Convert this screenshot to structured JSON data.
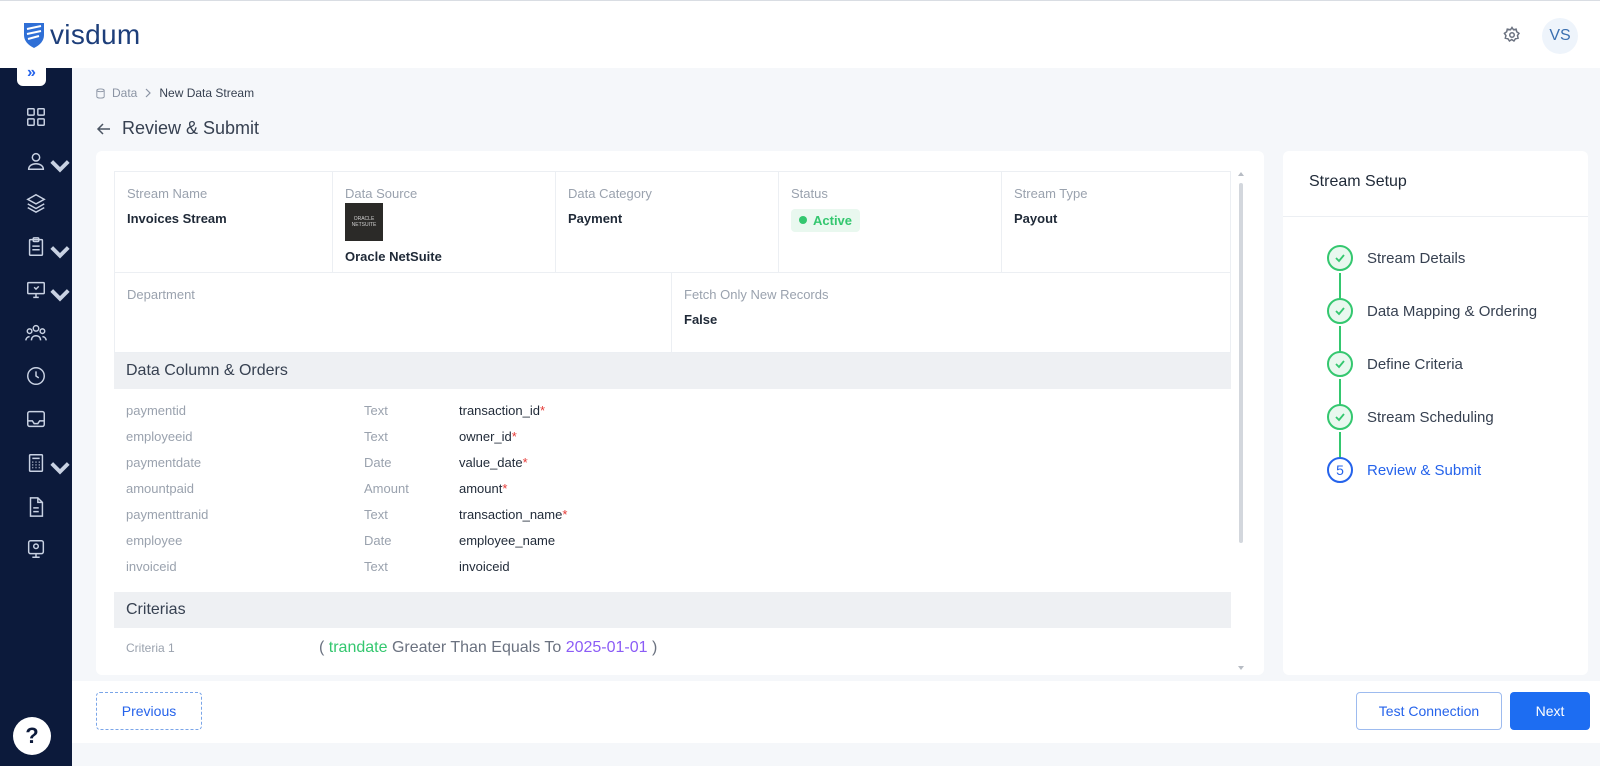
{
  "app": {
    "name": "visdum"
  },
  "header": {
    "avatar_initials": "VS",
    "settings_icon": "gear-icon"
  },
  "sidebar": {
    "expand_icon": "double-chevron-right-icon",
    "items": [
      {
        "icon": "dashboard-grid-icon",
        "has_caret": false
      },
      {
        "icon": "user-icon",
        "has_caret": true
      },
      {
        "icon": "layers-icon",
        "has_caret": false
      },
      {
        "icon": "clipboard-icon",
        "has_caret": true
      },
      {
        "icon": "monitor-icon",
        "has_caret": true
      },
      {
        "icon": "team-icon",
        "has_caret": false
      },
      {
        "icon": "clock-icon",
        "has_caret": false
      },
      {
        "icon": "inbox-icon",
        "has_caret": false
      },
      {
        "icon": "calculator-icon",
        "has_caret": true
      },
      {
        "icon": "document-icon",
        "has_caret": false
      },
      {
        "icon": "presentation-icon",
        "has_caret": false
      }
    ],
    "help_label": "?"
  },
  "breadcrumb": {
    "root": "Data",
    "current": "New Data Stream"
  },
  "page": {
    "title": "Review & Submit"
  },
  "details": {
    "stream_name": {
      "label": "Stream Name",
      "value": "Invoices Stream"
    },
    "data_source": {
      "label": "Data Source",
      "value": "Oracle NetSuite",
      "logo_text": "ORACLE NETSUITE"
    },
    "data_category": {
      "label": "Data Category",
      "value": "Payment"
    },
    "status": {
      "label": "Status",
      "value": "Active",
      "color": "#34c76f"
    },
    "stream_type": {
      "label": "Stream Type",
      "value": "Payout"
    },
    "department": {
      "label": "Department",
      "value": ""
    },
    "fetch_only_new": {
      "label": "Fetch Only New Records",
      "value": "False"
    }
  },
  "columns_section": {
    "title": "Data Column & Orders",
    "rows": [
      {
        "source": "paymentid",
        "type": "Text",
        "target": "transaction_id",
        "required": "*"
      },
      {
        "source": "employeeid",
        "type": "Text",
        "target": "owner_id",
        "required": "*"
      },
      {
        "source": "paymentdate",
        "type": "Date",
        "target": "value_date",
        "required": "*"
      },
      {
        "source": "amountpaid",
        "type": "Amount",
        "target": "amount",
        "required": "*"
      },
      {
        "source": "paymenttranid",
        "type": "Text",
        "target": "transaction_name",
        "required": "*"
      },
      {
        "source": "employee",
        "type": "Date",
        "target": "employee_name",
        "required": ""
      },
      {
        "source": "invoiceid",
        "type": "Text",
        "target": "invoiceid",
        "required": ""
      }
    ]
  },
  "criteria_section": {
    "title": "Criterias",
    "items": [
      {
        "label": "Criteria 1",
        "open": "(",
        "field": "trandate",
        "operator": "Greater Than Equals To",
        "value": "2025-01-01",
        "close": ")"
      }
    ]
  },
  "stream_setup": {
    "title": "Stream Setup",
    "steps": [
      {
        "label": "Stream Details",
        "state": "done"
      },
      {
        "label": "Data Mapping & Ordering",
        "state": "done"
      },
      {
        "label": "Define Criteria",
        "state": "done"
      },
      {
        "label": "Stream Scheduling",
        "state": "done"
      },
      {
        "label": "Review & Submit",
        "state": "current",
        "number": "5"
      }
    ]
  },
  "footer": {
    "previous_label": "Previous",
    "test_label": "Test Connection",
    "next_label": "Next"
  },
  "colors": {
    "accent": "#1d6df2",
    "sidebar": "#0c1a3b",
    "success": "#34c76f"
  }
}
